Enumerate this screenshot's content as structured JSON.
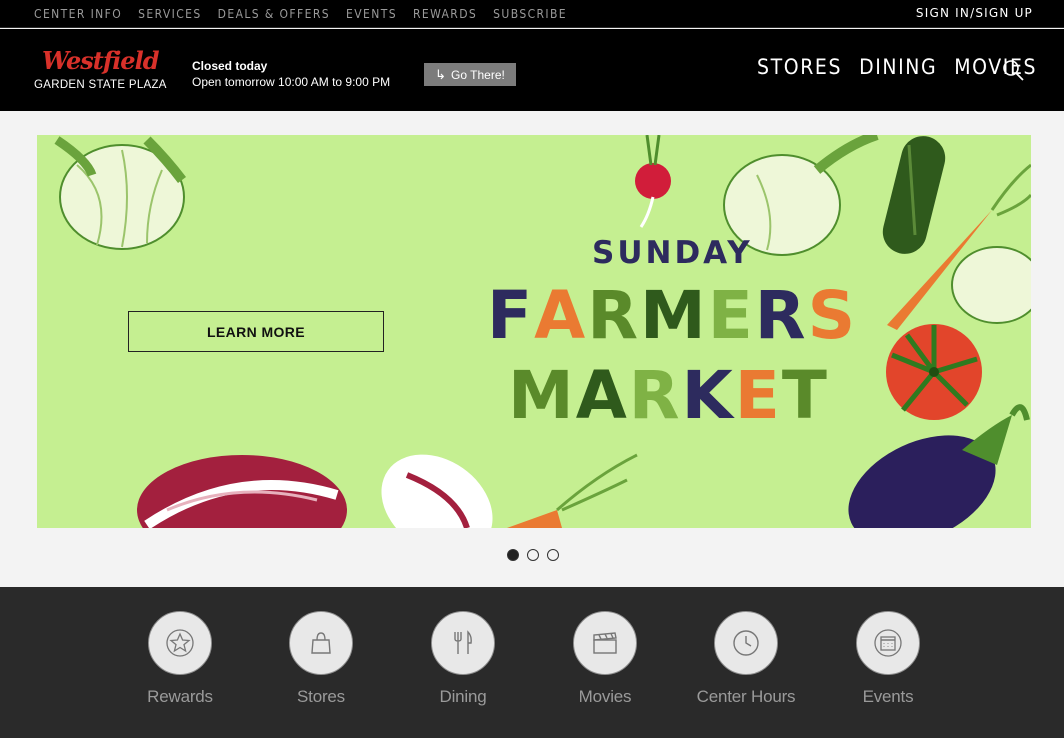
{
  "topbar": {
    "links": [
      "CENTER INFO",
      "SERVICES",
      "DEALS & OFFERS",
      "EVENTS",
      "REWARDS",
      "SUBSCRIBE"
    ],
    "sign_in": "SIGN IN/SIGN UP"
  },
  "header": {
    "logo_script": "Westfield",
    "logo_sub": "GARDEN STATE PLAZA",
    "status": "Closed today",
    "next_open": "Open tomorrow 10:00 AM to 9:00 PM",
    "go_label": "Go There!",
    "nav": [
      "STORES",
      "DINING",
      "MOVIES"
    ],
    "search_icon": "search-icon"
  },
  "hero": {
    "headline_small": "SUNDAY",
    "headline_word_1": "FARMERS",
    "headline_word_2": "MARKET",
    "cta": "LEARN MORE",
    "background": "#c5ef91",
    "letter_colors": [
      "#2d2b5e",
      "#ea7a32",
      "#5a8a2a",
      "#2f5a1c",
      "#7fb245"
    ]
  },
  "carousel": {
    "slides": 3,
    "active": 1
  },
  "quick_links": [
    {
      "label": "Rewards",
      "icon": "star-icon"
    },
    {
      "label": "Stores",
      "icon": "shopping-bag-icon"
    },
    {
      "label": "Dining",
      "icon": "fork-knife-icon"
    },
    {
      "label": "Movies",
      "icon": "clapperboard-icon"
    },
    {
      "label": "Center Hours",
      "icon": "clock-icon"
    },
    {
      "label": "Events",
      "icon": "calendar-icon"
    }
  ]
}
